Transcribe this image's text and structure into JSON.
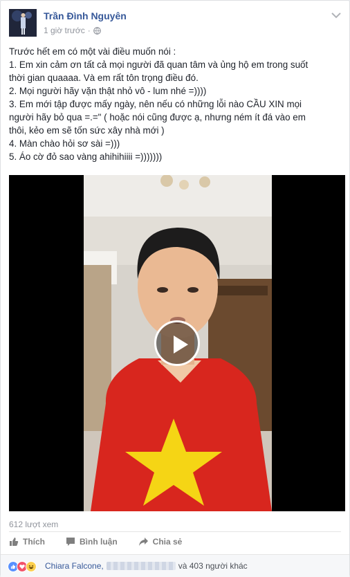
{
  "post": {
    "author": "Trần Đình Nguyên",
    "time": "1 giờ trước",
    "separator": "·",
    "lines": [
      "Trước hết em có một vài điều muốn nói :",
      "1. Em xin cảm ơn tất cả mọi người đã quan tâm và ủng hộ em trong suốt",
      "thời gian quaaaa. Và em rất tôn trọng điều đó.",
      "2. Mọi người hãy vặn thật nhỏ vô - lum nhé =))))",
      "3. Em mới tập được mấy ngày, nên nếu có những lỗi nào CẦU XIN mọi",
      "người hãy bỏ qua =.=\" ( hoặc nói cũng được ạ, nhưng ném ít đá vào em",
      "thôi, kẻo em sẽ tốn sức xây nhà mới )",
      "4. Màn chào hỏi sơ sài =)))",
      "5. Áo cờ đỏ sao vàng ahihihiiii =)))))))"
    ]
  },
  "video": {
    "views": "612 lượt xem"
  },
  "actions": {
    "like": "Thích",
    "comment": "Bình luận",
    "share": "Chia sẻ"
  },
  "reactions": {
    "name": "Chiara Falcone,",
    "others": "và 403 người khác",
    "types": [
      "like-icon",
      "love-icon",
      "haha-icon"
    ],
    "colors": {
      "like": "#5890ff",
      "love": "#f25268",
      "haha": "#fcd04f"
    }
  },
  "colors": {
    "link": "#365899",
    "meta": "#90949c",
    "shirt": "#d8261e",
    "star": "#f5d515"
  }
}
